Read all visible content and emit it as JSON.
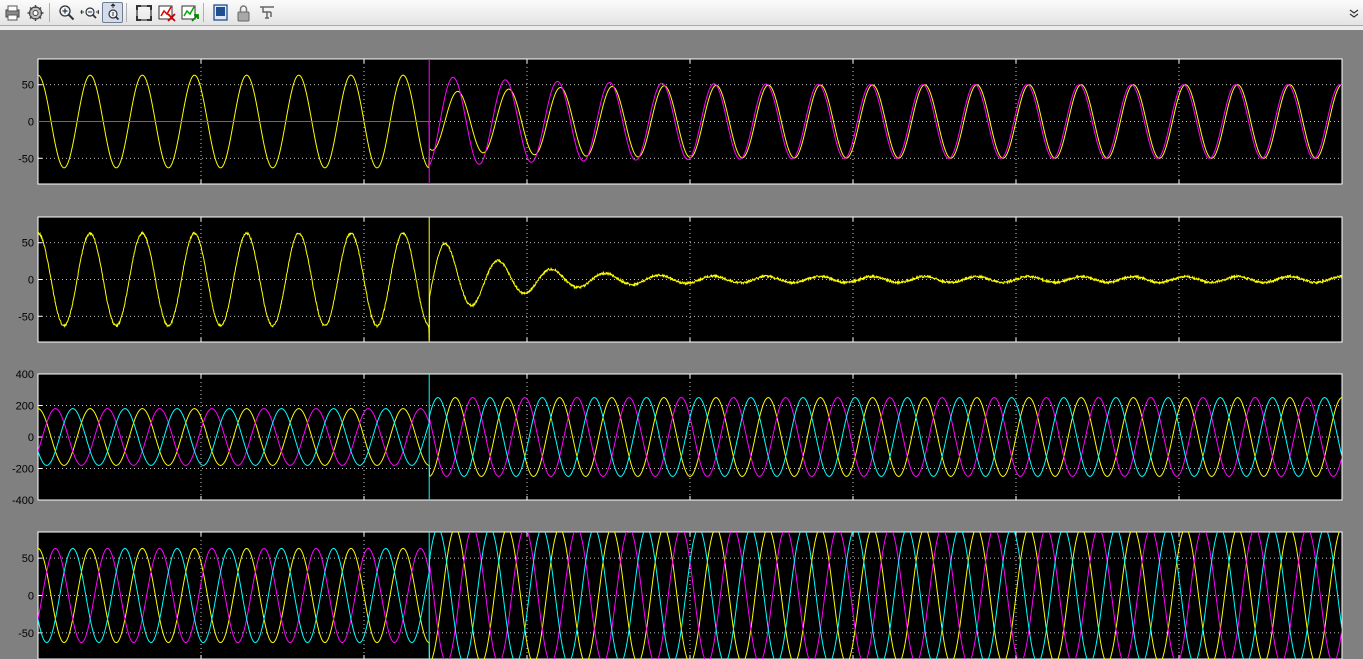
{
  "toolbar": {
    "buttons": [
      {
        "name": "print-button",
        "icon": "printer-icon"
      },
      {
        "name": "parameters-button",
        "icon": "gear-icon"
      },
      {
        "name": "zoom-in-button",
        "icon": "zoom-in-icon"
      },
      {
        "name": "zoom-x-button",
        "icon": "zoom-x-icon"
      },
      {
        "name": "zoom-y-button",
        "icon": "zoom-y-icon",
        "pressed": true
      },
      {
        "name": "autoscale-button",
        "icon": "autoscale-icon"
      },
      {
        "name": "save-axes-button",
        "icon": "save-axes-icon"
      },
      {
        "name": "restore-axes-button",
        "icon": "restore-axes-icon"
      },
      {
        "name": "floating-scope-button",
        "icon": "floating-scope-icon"
      },
      {
        "name": "lock-axes-button",
        "icon": "lock-icon"
      },
      {
        "name": "signal-selection-button",
        "icon": "signal-selection-icon"
      }
    ]
  },
  "colors": {
    "background": "#808080",
    "axes": "#000000",
    "grid": "#ffffff",
    "yellow": "#ffff00",
    "magenta": "#ff00ff",
    "cyan": "#00ffff"
  },
  "chart_data": [
    {
      "type": "line",
      "grid": true,
      "ylim": [
        -85,
        85
      ],
      "yticks": [
        "50",
        "0",
        "-50"
      ],
      "yticks_values": [
        50,
        0,
        -50
      ],
      "xlim": [
        0,
        0.5
      ],
      "event_time": 0.15,
      "frequency_hz": 50,
      "series": [
        {
          "color": "#ffff00",
          "segments": [
            [
              0,
              0.15,
              63,
              0
            ],
            [
              0.15,
              0.5,
              50,
              0
            ]
          ],
          "transient": {
            "amp": -20,
            "tau": 0.04,
            "phase": 0.8
          }
        },
        {
          "color": "#ff00ff",
          "segments": [
            [
              0,
              0.15,
              0,
              0
            ],
            [
              0.15,
              0.5,
              50,
              0.25
            ]
          ],
          "transient": {
            "amp": 12,
            "tau": 0.05,
            "phase": 0.3
          }
        }
      ]
    },
    {
      "type": "line",
      "grid": true,
      "ylim": [
        -85,
        85
      ],
      "yticks": [
        "50",
        "0",
        "-50"
      ],
      "yticks_values": [
        50,
        0,
        -50
      ],
      "xlim": [
        0,
        0.5
      ],
      "event_time": 0.15,
      "frequency_hz": 50,
      "series": [
        {
          "color": "#ffff00",
          "segments": [
            [
              0,
              0.15,
              63,
              0
            ],
            [
              0.15,
              0.5,
              4,
              0
            ]
          ],
          "transient": {
            "amp": 58,
            "tau": 0.03,
            "phase": 1.2
          },
          "noise": 1.5
        }
      ]
    },
    {
      "type": "line",
      "grid": true,
      "ylim": [
        -400,
        400
      ],
      "yticks": [
        "400",
        "200",
        "0",
        "-200",
        "-400"
      ],
      "yticks_values": [
        400,
        200,
        0,
        -200,
        -400
      ],
      "xlim": [
        0,
        0.5
      ],
      "event_time": 0.15,
      "frequency_hz": 50,
      "series": [
        {
          "color": "#ffff00",
          "segments": [
            [
              0,
              0.15,
              180,
              0
            ],
            [
              0.15,
              0.5,
              250,
              0
            ]
          ]
        },
        {
          "color": "#ff00ff",
          "segments": [
            [
              0,
              0.15,
              180,
              -2.094
            ],
            [
              0.15,
              0.5,
              250,
              -2.094
            ]
          ]
        },
        {
          "color": "#00ffff",
          "segments": [
            [
              0,
              0.15,
              180,
              2.094
            ],
            [
              0.15,
              0.5,
              250,
              2.094
            ]
          ]
        }
      ]
    },
    {
      "type": "line",
      "grid": true,
      "ylim": [
        -85,
        85
      ],
      "yticks": [
        "50",
        "0",
        "-50"
      ],
      "yticks_values": [
        50,
        0,
        -50
      ],
      "xlim": [
        0,
        0.5
      ],
      "event_time": 0.15,
      "frequency_hz": 50,
      "series": [
        {
          "color": "#ffff00",
          "segments": [
            [
              0,
              0.15,
              63,
              0
            ],
            [
              0.15,
              0.5,
              90,
              0
            ]
          ]
        },
        {
          "color": "#ff00ff",
          "segments": [
            [
              0,
              0.15,
              63,
              -2.094
            ],
            [
              0.15,
              0.5,
              90,
              -2.094
            ]
          ]
        },
        {
          "color": "#00ffff",
          "segments": [
            [
              0,
              0.15,
              63,
              2.094
            ],
            [
              0.15,
              0.5,
              90,
              2.094
            ]
          ]
        }
      ]
    }
  ]
}
